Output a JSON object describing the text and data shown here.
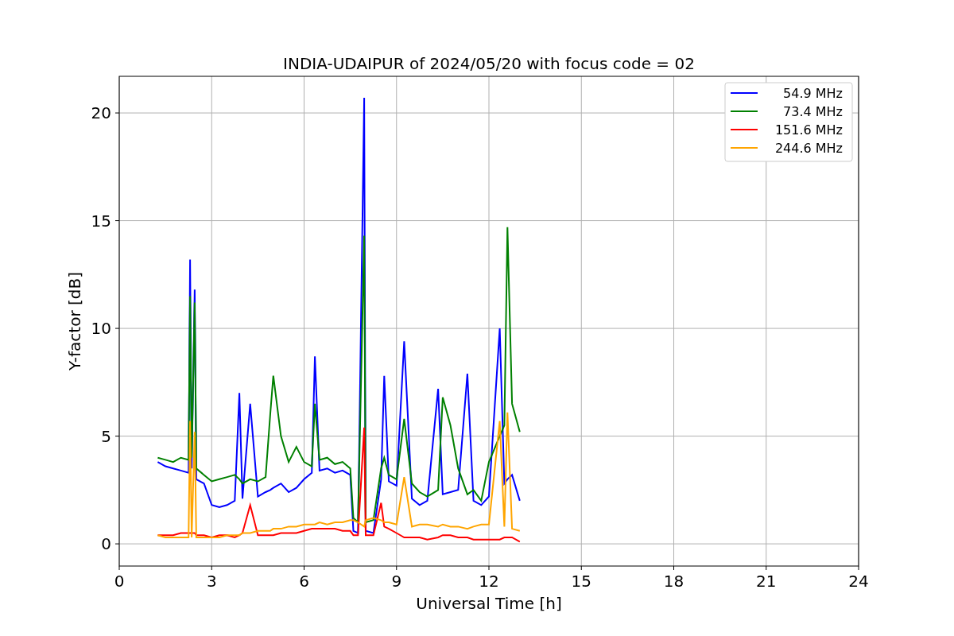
{
  "chart_data": {
    "type": "line",
    "title": "INDIA-UDAIPUR of 2024/05/20 with focus code = 02",
    "xlabel": "Universal Time [h]",
    "ylabel": "Y-factor [dB]",
    "x": [
      1.25,
      1.5,
      1.75,
      2.0,
      2.25,
      2.3,
      2.35,
      2.45,
      2.5,
      2.75,
      3.0,
      3.25,
      3.5,
      3.75,
      3.9,
      4.0,
      4.25,
      4.5,
      4.75,
      4.9,
      5.0,
      5.25,
      5.5,
      5.75,
      6.0,
      6.25,
      6.35,
      6.5,
      6.75,
      7.0,
      7.25,
      7.5,
      7.6,
      7.75,
      7.95,
      8.0,
      8.25,
      8.5,
      8.6,
      8.75,
      9.0,
      9.25,
      9.5,
      9.75,
      10.0,
      10.35,
      10.5,
      10.75,
      11.0,
      11.3,
      11.5,
      11.75,
      12.0,
      12.35,
      12.5,
      12.6,
      12.75,
      13.0
    ],
    "series": [
      {
        "name": " 54.9 MHz",
        "color": "#0000ff",
        "values": [
          3.8,
          3.6,
          3.5,
          3.4,
          3.3,
          13.2,
          3.5,
          11.8,
          3.0,
          2.8,
          1.8,
          1.7,
          1.8,
          2.0,
          7.0,
          2.1,
          6.5,
          2.2,
          2.4,
          2.5,
          2.6,
          2.8,
          2.4,
          2.6,
          3.0,
          3.3,
          8.7,
          3.4,
          3.5,
          3.3,
          3.4,
          3.2,
          0.6,
          0.5,
          20.7,
          0.6,
          0.5,
          3.0,
          7.8,
          2.9,
          2.7,
          9.4,
          2.1,
          1.8,
          2.0,
          7.2,
          2.3,
          2.4,
          2.5,
          7.9,
          2.0,
          1.8,
          2.2,
          10.0,
          2.8,
          3.0,
          3.2,
          2.0
        ]
      },
      {
        "name": " 73.4 MHz",
        "color": "#008000",
        "values": [
          4.0,
          3.9,
          3.8,
          4.0,
          3.9,
          11.5,
          4.0,
          11.2,
          3.5,
          3.2,
          2.9,
          3.0,
          3.1,
          3.2,
          3.0,
          2.8,
          3.0,
          2.9,
          3.1,
          6.0,
          7.8,
          5.0,
          3.8,
          4.5,
          3.8,
          3.6,
          6.5,
          3.9,
          4.0,
          3.7,
          3.8,
          3.5,
          1.2,
          1.0,
          14.3,
          1.0,
          1.1,
          3.5,
          4.0,
          3.2,
          3.0,
          5.8,
          2.8,
          2.4,
          2.2,
          2.5,
          6.8,
          5.5,
          3.5,
          2.3,
          2.5,
          2.0,
          3.8,
          5.0,
          5.5,
          14.7,
          6.5,
          5.2
        ]
      },
      {
        "name": "151.6 MHz",
        "color": "#ff0000",
        "values": [
          0.4,
          0.4,
          0.4,
          0.5,
          0.5,
          0.5,
          0.5,
          0.5,
          0.4,
          0.4,
          0.3,
          0.4,
          0.4,
          0.3,
          0.4,
          0.5,
          1.8,
          0.4,
          0.4,
          0.4,
          0.4,
          0.5,
          0.5,
          0.5,
          0.6,
          0.7,
          0.7,
          0.7,
          0.7,
          0.7,
          0.6,
          0.6,
          0.4,
          0.4,
          5.4,
          0.4,
          0.4,
          1.9,
          0.8,
          0.7,
          0.5,
          0.3,
          0.3,
          0.3,
          0.2,
          0.3,
          0.4,
          0.4,
          0.3,
          0.3,
          0.2,
          0.2,
          0.2,
          0.2,
          0.3,
          0.3,
          0.3,
          0.1
        ]
      },
      {
        "name": "244.6 MHz",
        "color": "#ffa500",
        "values": [
          0.4,
          0.3,
          0.3,
          0.3,
          0.3,
          5.7,
          0.3,
          5.2,
          0.3,
          0.3,
          0.3,
          0.3,
          0.4,
          0.4,
          0.4,
          0.5,
          0.5,
          0.6,
          0.6,
          0.6,
          0.7,
          0.7,
          0.8,
          0.8,
          0.9,
          0.9,
          0.9,
          1.0,
          0.9,
          1.0,
          1.0,
          1.1,
          1.1,
          1.0,
          0.8,
          1.1,
          1.2,
          1.1,
          1.0,
          1.0,
          0.9,
          3.1,
          0.8,
          0.9,
          0.9,
          0.8,
          0.9,
          0.8,
          0.8,
          0.7,
          0.8,
          0.9,
          0.9,
          5.7,
          0.8,
          6.1,
          0.7,
          0.6
        ]
      }
    ],
    "xlim": [
      0,
      24
    ],
    "ylim": [
      -1.03,
      21.7
    ],
    "xticks": [
      0,
      3,
      6,
      9,
      12,
      15,
      18,
      21,
      24
    ],
    "yticks": [
      0,
      5,
      10,
      15,
      20
    ],
    "grid": true,
    "legend": "upper right"
  }
}
